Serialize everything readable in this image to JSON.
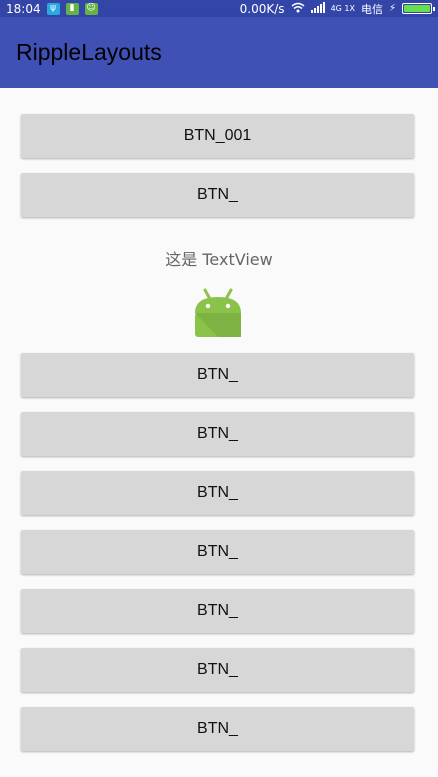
{
  "status_bar": {
    "time": "18:04",
    "net_speed": "0.00K/s",
    "signal_label": "4G 1X",
    "carrier": "电信",
    "icons": [
      "usb-icon",
      "sd-card-icon",
      "android-icon",
      "wifi-icon",
      "signal-icon",
      "charging-icon",
      "battery-icon"
    ],
    "battery_level": 1.0
  },
  "app_bar": {
    "title": "RippleLayouts",
    "color": "#3f51b5"
  },
  "buttons": [
    "BTN_001",
    "BTN_",
    "BTN_",
    "BTN_",
    "BTN_",
    "BTN_",
    "BTN_",
    "BTN_",
    "BTN_"
  ],
  "text_view": "这是 TextView",
  "image_icon": "android-robot-icon"
}
